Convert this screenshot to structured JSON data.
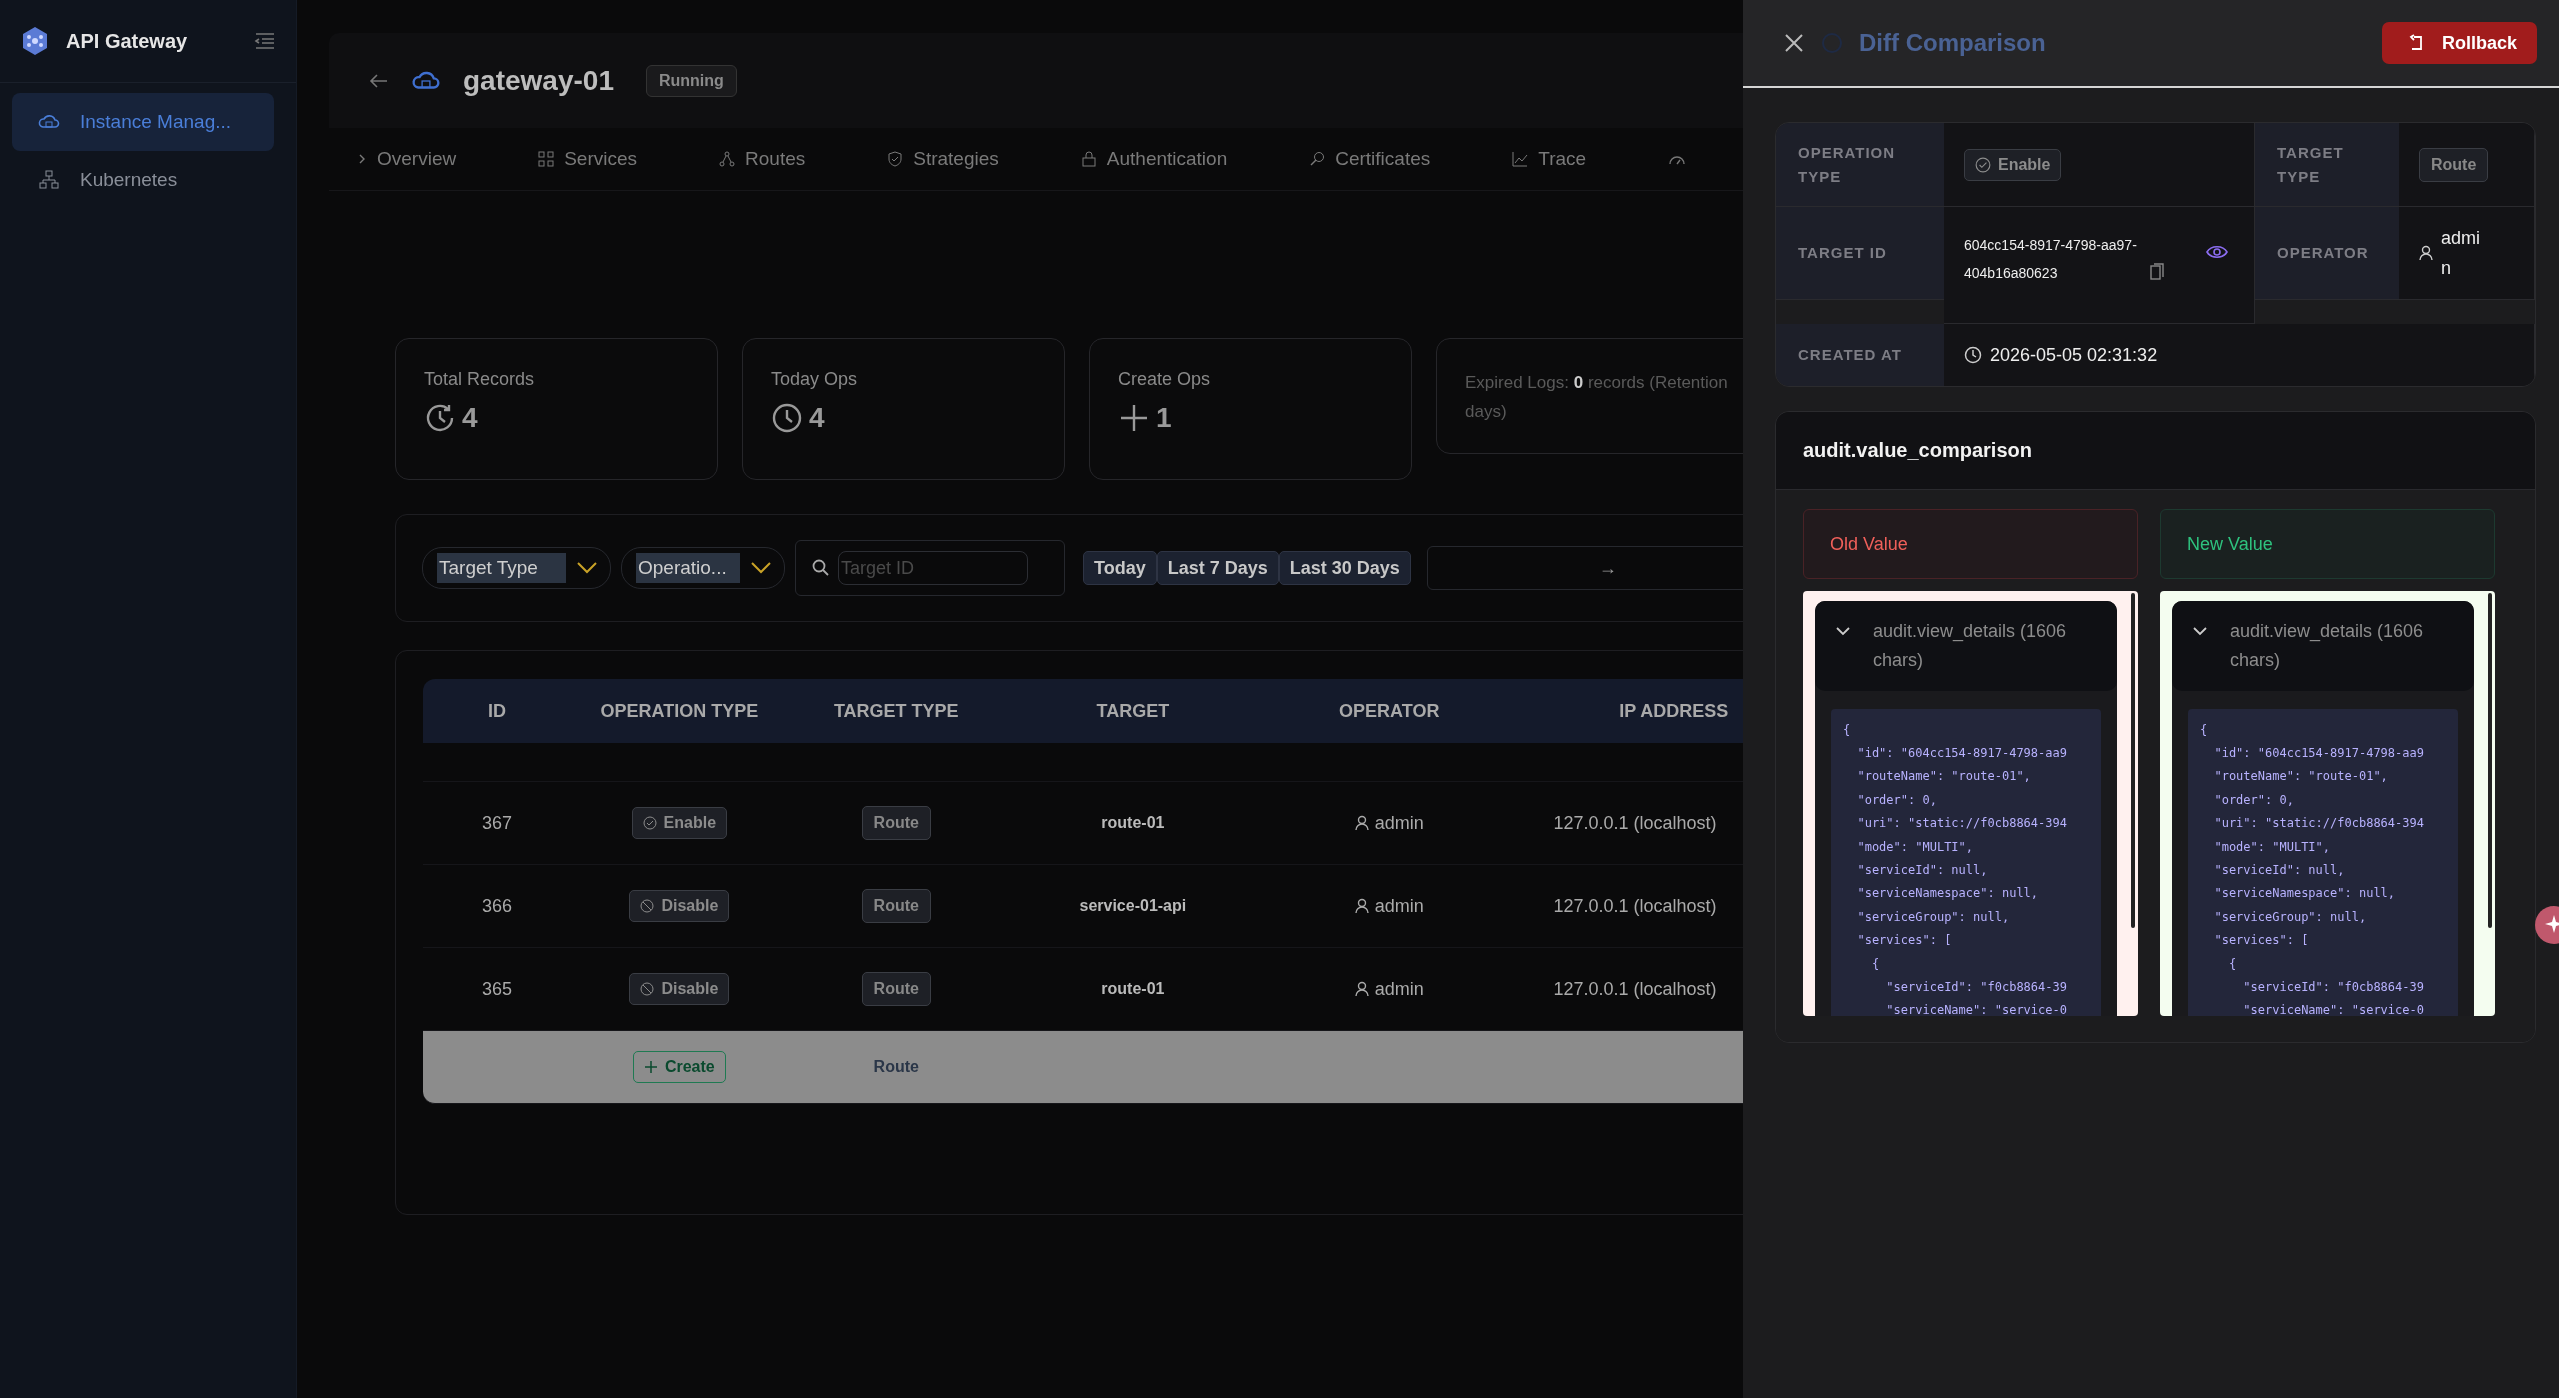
{
  "sidebar": {
    "app_name": "API Gateway",
    "items": [
      {
        "label": "Instance Manag...",
        "kind": "cloud",
        "selected": true
      },
      {
        "label": "Kubernetes",
        "kind": "cluster",
        "selected": false
      }
    ]
  },
  "header": {
    "title": "gateway-01",
    "status": "Running"
  },
  "tabs": [
    {
      "label": "Overview",
      "kind": "chevron"
    },
    {
      "label": "Services",
      "kind": "grid"
    },
    {
      "label": "Routes",
      "kind": "nodes"
    },
    {
      "label": "Strategies",
      "kind": "shield"
    },
    {
      "label": "Authentication",
      "kind": "lock"
    },
    {
      "label": "Certificates",
      "kind": "search"
    },
    {
      "label": "Trace",
      "kind": "chart"
    }
  ],
  "stats": [
    {
      "label": "Total Records",
      "value": "4",
      "kind": "history"
    },
    {
      "label": "Today Ops",
      "value": "4",
      "kind": "clock"
    },
    {
      "label": "Create Ops",
      "value": "1",
      "kind": "plus"
    }
  ],
  "expired_note": "Expired Logs: **0** records (Retention\ndays)",
  "filters": {
    "target_type": "Target Type",
    "operation": "Operatio...",
    "search_placeholder": "Target ID",
    "date_buttons": [
      "Today",
      "Last 7 Days",
      "Last 30 Days"
    ],
    "range_separator": "→"
  },
  "table": {
    "columns": [
      "ID",
      "OPERATION TYPE",
      "TARGET TYPE",
      "TARGET",
      "OPERATOR",
      "IP ADDRESS"
    ],
    "rows": [
      {
        "id": "367",
        "operation": "Enable",
        "kind": "enable",
        "target_type": "Route",
        "target": "route-01",
        "operator": "admin",
        "ip": "127.0.0.1 (localhost)",
        "highlighted": false
      },
      {
        "id": "366",
        "operation": "Disable",
        "kind": "disable",
        "target_type": "Route",
        "target": "service-01-api",
        "operator": "admin",
        "ip": "127.0.0.1 (localhost)",
        "highlighted": false
      },
      {
        "id": "365",
        "operation": "Disable",
        "kind": "disable",
        "target_type": "Route",
        "target": "route-01",
        "operator": "admin",
        "ip": "127.0.0.1 (localhost)",
        "highlighted": false
      },
      {
        "operation": "Create",
        "kind": "create",
        "target_type": "Route",
        "highlighted": true
      }
    ]
  },
  "drawer": {
    "title": "Diff Comparison",
    "rollback": "Rollback",
    "info": {
      "operation_type_label": "OPERATION TYPE",
      "operation_type": "Enable",
      "target_type_label": "TARGET TYPE",
      "target_type": "Route",
      "target_id_label": "TARGET ID",
      "target_id": "604cc154-8917-4798-aa97-404b16a80623",
      "operator_label": "OPERATOR",
      "operator": "admin",
      "created_at_label": "CREATED AT",
      "created_at": "2026-05-05 02:31:32"
    },
    "comparison_title": "audit.value_comparison",
    "panels": [
      {
        "kind": "old",
        "heading": "Old Value",
        "summary": "audit.view_details (1606 chars)",
        "expanded": true,
        "code": [
          "{",
          "  \"id\": \"604cc154-8917-4798-aa9",
          "  \"routeName\": \"route-01\",",
          "  \"order\": 0,",
          "  \"uri\": \"static://f0cb8864-394",
          "  \"mode\": \"MULTI\",",
          "  \"serviceId\": null,",
          "  \"serviceNamespace\": null,",
          "  \"serviceGroup\": null,",
          "  \"services\": [",
          "    {",
          "      \"serviceId\": \"f0cb8864-39",
          "      \"serviceName\": \"service-0"
        ]
      },
      {
        "kind": "new",
        "heading": "New Value",
        "summary": "audit.view_details (1606 chars)",
        "expanded": true,
        "code": [
          "{",
          "  \"id\": \"604cc154-8917-4798-aa9",
          "  \"routeName\": \"route-01\",",
          "  \"order\": 0,",
          "  \"uri\": \"static://f0cb8864-394",
          "  \"mode\": \"MULTI\",",
          "  \"serviceId\": null,",
          "  \"serviceNamespace\": null,",
          "  \"serviceGroup\": null,",
          "  \"services\": [",
          "    {",
          "      \"serviceId\": \"f0cb8864-39",
          "      \"serviceName\": \"service-0"
        ]
      }
    ]
  }
}
